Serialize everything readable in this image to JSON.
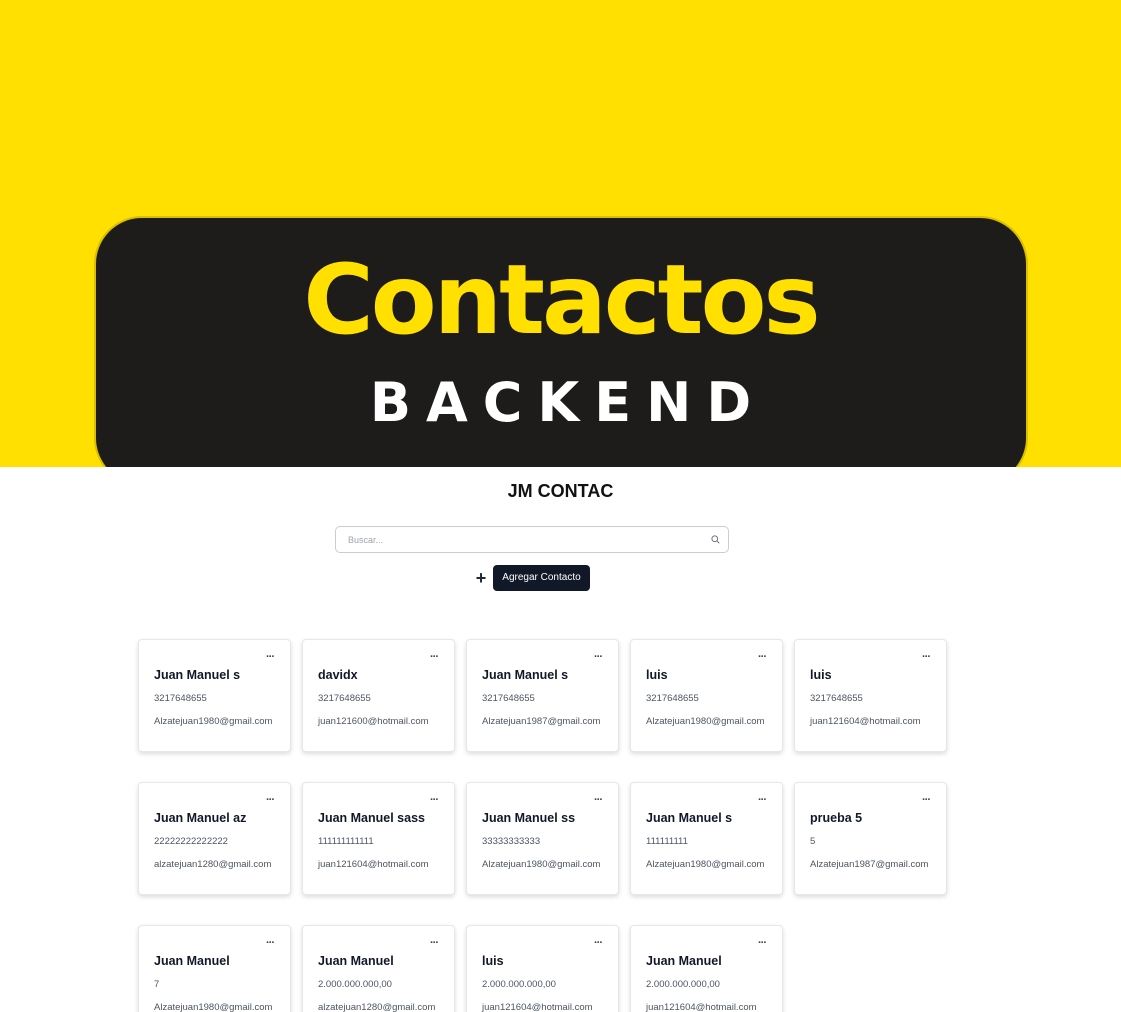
{
  "banner": {
    "title": "Contactos",
    "subtitle": "BACKEND"
  },
  "app": {
    "title": "JM CONTAC"
  },
  "search": {
    "placeholder": "Buscar..."
  },
  "actions": {
    "add_icon": "plus-icon",
    "add_label": "Agregar Contacto"
  },
  "colors": {
    "banner_yellow": "#ffe000",
    "banner_dark": "#1e1c1a",
    "button_dark": "#111827"
  },
  "contacts": [
    {
      "name": "Juan Manuel s",
      "phone": "3217648655",
      "email": "Alzatejuan1980@gmail.com"
    },
    {
      "name": "davidx",
      "phone": "3217648655",
      "email": "juan121600@hotmail.com"
    },
    {
      "name": "Juan Manuel s",
      "phone": "3217648655",
      "email": "Alzatejuan1987@gmail.com"
    },
    {
      "name": "luis",
      "phone": "3217648655",
      "email": "Alzatejuan1980@gmail.com"
    },
    {
      "name": "luis",
      "phone": "3217648655",
      "email": "juan121604@hotmail.com"
    },
    {
      "name": "Juan Manuel az",
      "phone": "22222222222222",
      "email": "alzatejuan1280@gmail.com"
    },
    {
      "name": "Juan Manuel sass",
      "phone": "111111111111",
      "email": "juan121604@hotmail.com"
    },
    {
      "name": "Juan Manuel ss",
      "phone": "33333333333",
      "email": "Alzatejuan1980@gmail.com"
    },
    {
      "name": "Juan Manuel s",
      "phone": "111111111",
      "email": "Alzatejuan1980@gmail.com"
    },
    {
      "name": "prueba 5",
      "phone": "5",
      "email": "Alzatejuan1987@gmail.com"
    },
    {
      "name": "Juan Manuel",
      "phone": "7",
      "email": "Alzatejuan1980@gmail.com"
    },
    {
      "name": "Juan Manuel",
      "phone": "2.000.000.000,00",
      "email": "alzatejuan1280@gmail.com"
    },
    {
      "name": "luis",
      "phone": "2.000.000.000,00",
      "email": "juan121604@hotmail.com"
    },
    {
      "name": "Juan Manuel",
      "phone": "2.000.000.000,00",
      "email": "juan121604@hotmail.com"
    }
  ],
  "card_menu_label": "···"
}
